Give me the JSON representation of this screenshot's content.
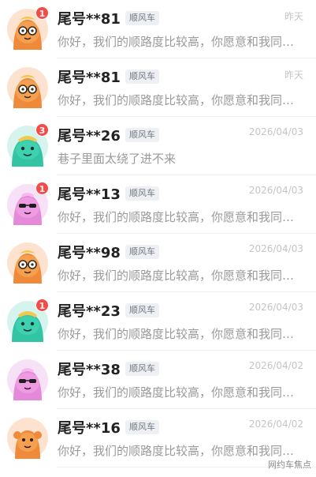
{
  "conversations": [
    {
      "name": "尾号**81",
      "tag": "顺风车",
      "time": "昨天",
      "message": "你好，我们的顺路度比较高，你愿意和我同行吗？",
      "unread": "1",
      "avatar": "orange-glasses"
    },
    {
      "name": "尾号**81",
      "tag": "顺风车",
      "time": "昨天",
      "message": "你好，我们的顺路度比较高，你愿意和我同行吗？",
      "unread": "",
      "avatar": "orange-glasses"
    },
    {
      "name": "尾号**26",
      "tag": "顺风车",
      "time": "2026/04/03",
      "message": "巷子里面太绕了进不来",
      "unread": "3",
      "avatar": "teal-cap"
    },
    {
      "name": "尾号**13",
      "tag": "顺风车",
      "time": "2026/04/03",
      "message": "你好，我们的顺路度比较高，你愿意和我同行吗？",
      "unread": "1",
      "avatar": "pink-sunglasses"
    },
    {
      "name": "尾号**98",
      "tag": "顺风车",
      "time": "2026/04/03",
      "message": "你好，我们的顺路度比较高，你愿意和我同行吗？",
      "unread": "",
      "avatar": "orange-glasses"
    },
    {
      "name": "尾号**23",
      "tag": "顺风车",
      "time": "2026/04/03",
      "message": "你好，我们的顺路度比较高，你愿意和我同行吗？",
      "unread": "1",
      "avatar": "teal-cap"
    },
    {
      "name": "尾号**38",
      "tag": "顺风车",
      "time": "2026/04/02",
      "message": "你好，我们的顺路度比较高，你愿意和我同行吗？",
      "unread": "",
      "avatar": "pink-sunglasses"
    },
    {
      "name": "尾号**16",
      "tag": "顺风车",
      "time": "2026/04/02",
      "message": "你好，我们的顺路度比较高，你愿意和我同行吗？",
      "unread": "",
      "avatar": "orange-plain"
    }
  ],
  "watermark": "网约车焦点",
  "colors": {
    "badge": "#f54a45",
    "tag_bg": "#eef0f3",
    "time": "#c4c4c4",
    "message": "#9a9a9a"
  }
}
